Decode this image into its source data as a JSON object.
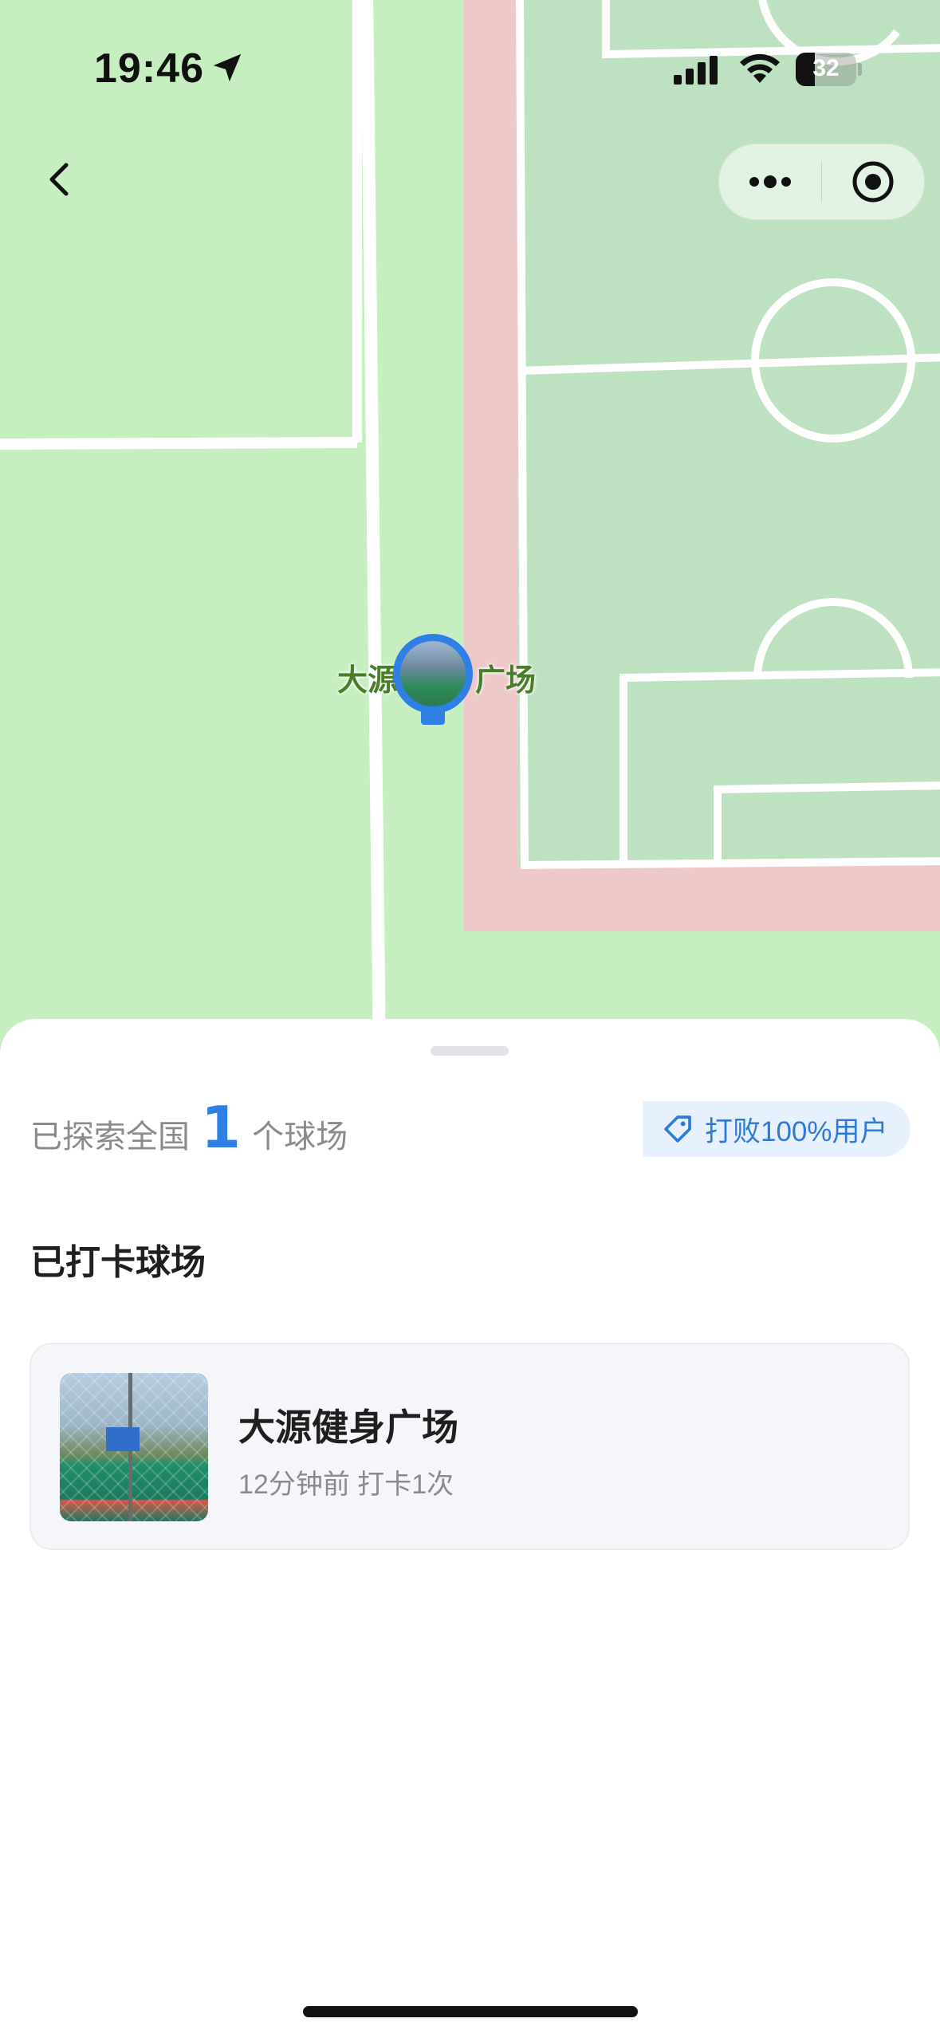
{
  "status_bar": {
    "time": "19:46",
    "battery_level": "32"
  },
  "nav": {
    "back_icon": "chevron-left-icon",
    "capsule_more_icon": "more-dots-icon",
    "capsule_close_icon": "target-circle-icon"
  },
  "map": {
    "marker_label_left": "大源",
    "marker_label_right": "广场",
    "colors": {
      "grass": "#c6eec0",
      "pitch": "#bfe3c2",
      "track": "#f0c8c8",
      "marker": "#2f80e5"
    }
  },
  "summary": {
    "prefix": "已探索全国",
    "count": "1",
    "suffix": "个球场",
    "badge": "打败100%用户"
  },
  "section": {
    "title": "已打卡球场"
  },
  "courts": [
    {
      "name": "大源健身广场",
      "meta": "12分钟前 打卡1次"
    }
  ]
}
